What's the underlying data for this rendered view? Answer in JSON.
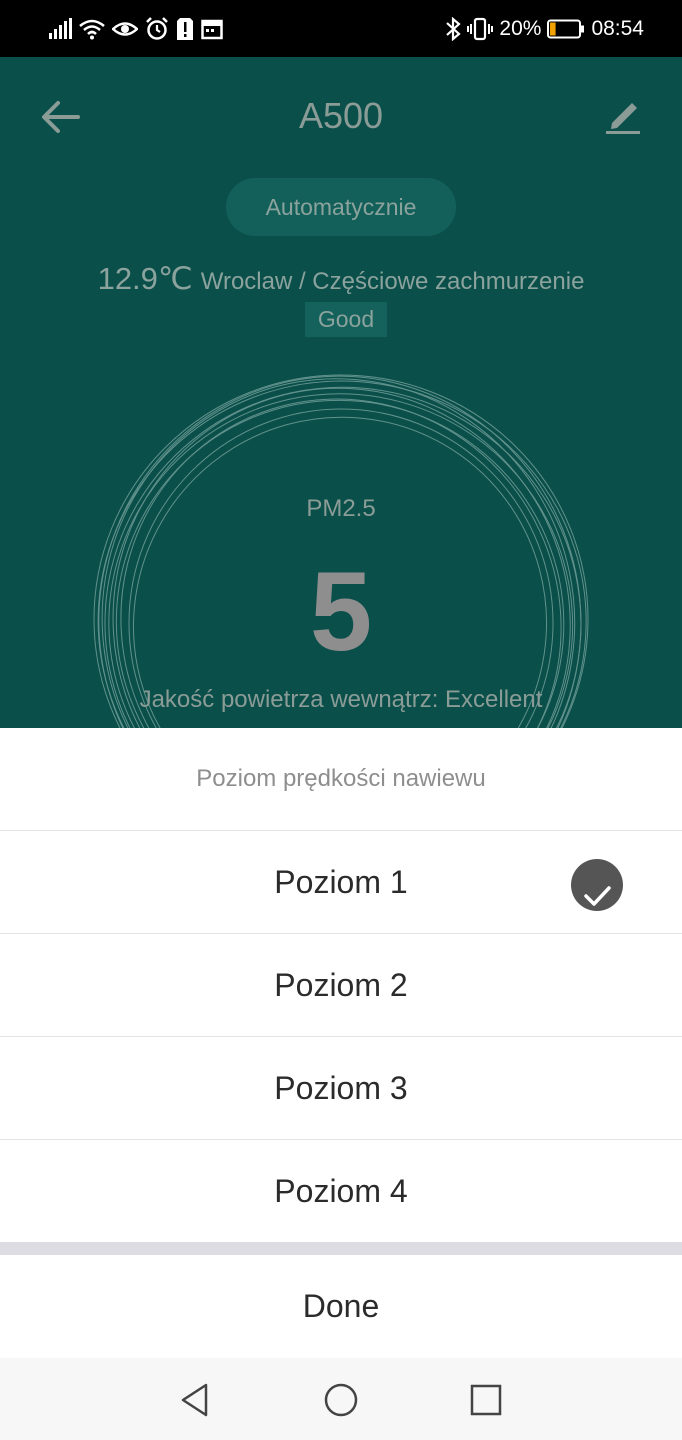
{
  "status_bar": {
    "icons_left": [
      "signal-icon",
      "wifi-icon",
      "eye-icon",
      "alarm-icon",
      "sim-alert-icon",
      "calendar-icon"
    ],
    "icons_right": [
      "bluetooth-icon",
      "vibrate-icon",
      "battery-icon"
    ],
    "battery": "20%",
    "battery_level": 0.2,
    "time": "08:54"
  },
  "header": {
    "back_icon": "arrow-back-icon",
    "title": "A500",
    "edit_icon": "pencil-icon"
  },
  "mode": "Automatycznie",
  "weather": {
    "temperature": "12.9℃",
    "description": "Wroclaw / Częściowe zachmurzenie",
    "air_quality_badge": "Good"
  },
  "pm": {
    "label": "PM2.5",
    "value": "5",
    "air_quality_text": "Jakość powietrza wewnątrz: Excellent"
  },
  "sheet": {
    "title": "Poziom prędkości nawiewu",
    "options": [
      {
        "label": "Poziom 1",
        "selected": true
      },
      {
        "label": "Poziom 2",
        "selected": false
      },
      {
        "label": "Poziom 3",
        "selected": false
      },
      {
        "label": "Poziom 4",
        "selected": false
      }
    ],
    "done_label": "Done"
  },
  "nav_bar": {
    "icons": [
      "nav-back-icon",
      "nav-home-icon",
      "nav-recent-icon"
    ]
  },
  "colors": {
    "app_background": "#0a4f4a",
    "pill_background": "#13605a",
    "check_background": "#555555",
    "battery_fill": "#f0a000"
  }
}
